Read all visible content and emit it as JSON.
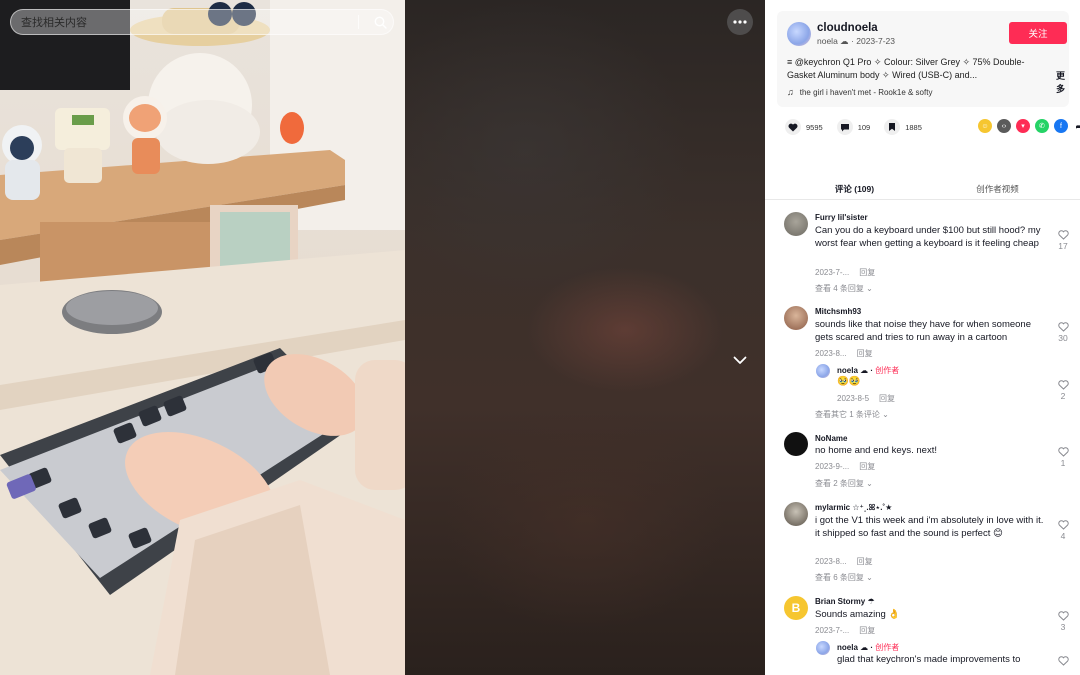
{
  "search": {
    "placeholder": "查找相关内容"
  },
  "video": {
    "more_label": "•••"
  },
  "author": {
    "name": "cloudnoela",
    "handle": "noela ☁",
    "date": "· 2023-7-23",
    "follow_label": "关注",
    "description": "≡ @keychron Q1 Pro ✧ Colour: Silver Grey ✧ 75% Double-Gasket Aluminum body ✧ Wired (USB-C) and...",
    "more_label": "更多",
    "music": "the girl i haven't met - Rook1e & softy"
  },
  "stats": {
    "likes": "9595",
    "comments": "109",
    "saves": "1885"
  },
  "share_icons": [
    "embed-icon",
    "code-icon",
    "send-icon",
    "whatsapp-icon",
    "facebook-icon",
    "share-arrow-icon"
  ],
  "tabs": {
    "comments": "评论 (109)",
    "creator_videos": "创作者视频"
  },
  "comments": [
    {
      "user": "Furry lil'sister",
      "text": "Can you do a keyboard under $100 but still hood? my worst fear when getting a keyboard is it feeling cheap",
      "date": "2023-7-...",
      "reply_label": "回复",
      "likes": "17",
      "expand": "查看 4 条回复 ⌄"
    },
    {
      "user": "Mitchsmh93",
      "text": "sounds like that noise they have for when someone gets scared and tries to run away in a cartoon",
      "date": "2023-8...",
      "reply_label": "回复",
      "likes": "30",
      "reply": {
        "user": "noela ☁ ·",
        "creator": "创作者",
        "text": "🥹🥹",
        "date": "2023-8-5",
        "reply_label": "回复",
        "likes": "2"
      },
      "expand": "查看其它 1 条评论 ⌄"
    },
    {
      "user": "NoName",
      "text": "no home and end keys. next!",
      "date": "2023-9-...",
      "reply_label": "回复",
      "likes": "1",
      "expand": "查看 2 条回复 ⌄"
    },
    {
      "user": "mylarmic ☆⁺˳.ꕤ⋆.˚★",
      "text": "i got the V1 this week and i'm absolutely in love with it. it shipped so fast and the sound is perfect 😊",
      "date": "2023-8...",
      "reply_label": "回复",
      "likes": "4",
      "expand": "查看 6 条回复 ⌄"
    },
    {
      "user": "Brian Stormy ☂",
      "text": "Sounds amazing 👌",
      "date": "2023-7-...",
      "reply_label": "回复",
      "likes": "3",
      "reply": {
        "user": "noela ☁ ·",
        "creator": "创作者",
        "text": "glad that keychron's made improvements to",
        "likes": ""
      }
    }
  ],
  "colors": {
    "accent": "#fe2c55",
    "text": "#161823",
    "muted": "#8a8b91"
  }
}
